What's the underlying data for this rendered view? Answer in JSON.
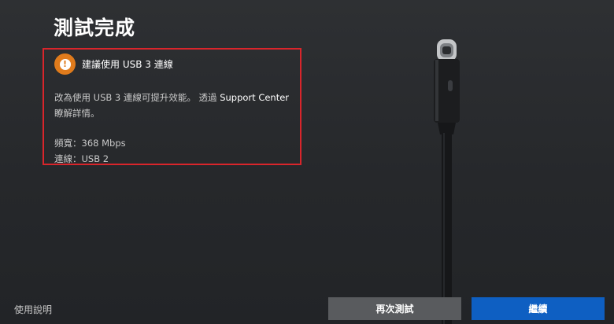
{
  "page": {
    "title": "測試完成"
  },
  "warning": {
    "icon": "warning-icon",
    "icon_color": "#e07b1c",
    "title": "建議使用 USB 3 連線",
    "message_before": "改為使用 USB 3 連線可提升效能。 透過 ",
    "link_text": "Support Center",
    "message_after": " 瞭解詳情。",
    "bandwidth": "頻寬：368 Mbps",
    "connection": "連線：USB 2",
    "highlight_color": "#d9252b"
  },
  "footer": {
    "help_link": "使用說明",
    "retry_button": "再次測試",
    "continue_button": "繼續"
  },
  "colors": {
    "background": "#2a2c2f",
    "primary_button": "#0e5fc2",
    "secondary_button": "#595b5e"
  },
  "illustration": {
    "icon": "usb-c-cable-icon"
  }
}
